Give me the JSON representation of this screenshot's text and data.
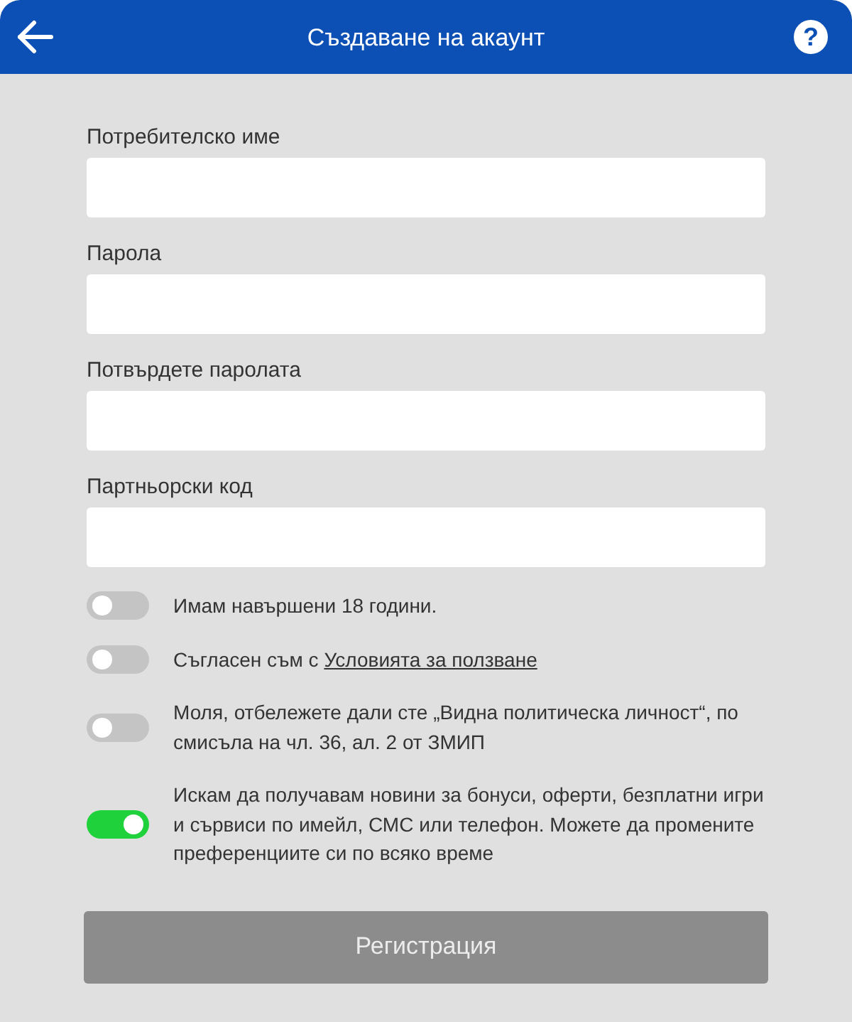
{
  "header": {
    "title": "Създаване на акаунт",
    "help": "?"
  },
  "fields": [
    {
      "label": "Потребителско име"
    },
    {
      "label": "Парола"
    },
    {
      "label": "Потвърдете паролата"
    },
    {
      "label": "Партньорски код"
    }
  ],
  "toggles": [
    {
      "text": "Имам навършени 18 години.",
      "on": false
    },
    {
      "text": "Съгласен съм с",
      "link": "Условията за ползване",
      "on": false
    },
    {
      "text": "Моля, отбележете дали сте „Видна политическа личност“, по смисъла на чл. 36, ал. 2 от ЗМИП",
      "on": false
    },
    {
      "text": "Искам да получавам новини за бонуси, оферти, безплатни игри и сървиси по имейл, СМС или телефон. Можете да промените преференциите си по всяко време",
      "on": true
    }
  ],
  "submit": {
    "label": "Регистрация",
    "disabled": true
  }
}
